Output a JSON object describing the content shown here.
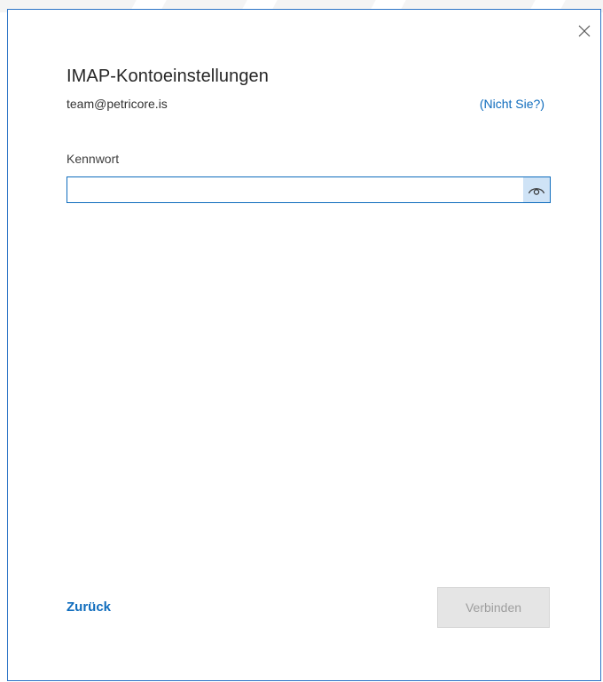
{
  "dialog": {
    "title": "IMAP-Kontoeinstellungen",
    "account_email": "team@petricore.is",
    "not_you_link": "(Nicht Sie?)",
    "close_icon": "close-icon"
  },
  "password": {
    "label": "Kennwort",
    "value": "",
    "placeholder": "",
    "reveal_icon": "eye-icon"
  },
  "footer": {
    "back_label": "Zurück",
    "connect_label": "Verbinden",
    "connect_enabled": false
  },
  "colors": {
    "accent": "#0f6cbd",
    "border": "#2b73c6",
    "disabled_button_bg": "#e5e5e5",
    "disabled_button_text": "#9e9e9e"
  }
}
